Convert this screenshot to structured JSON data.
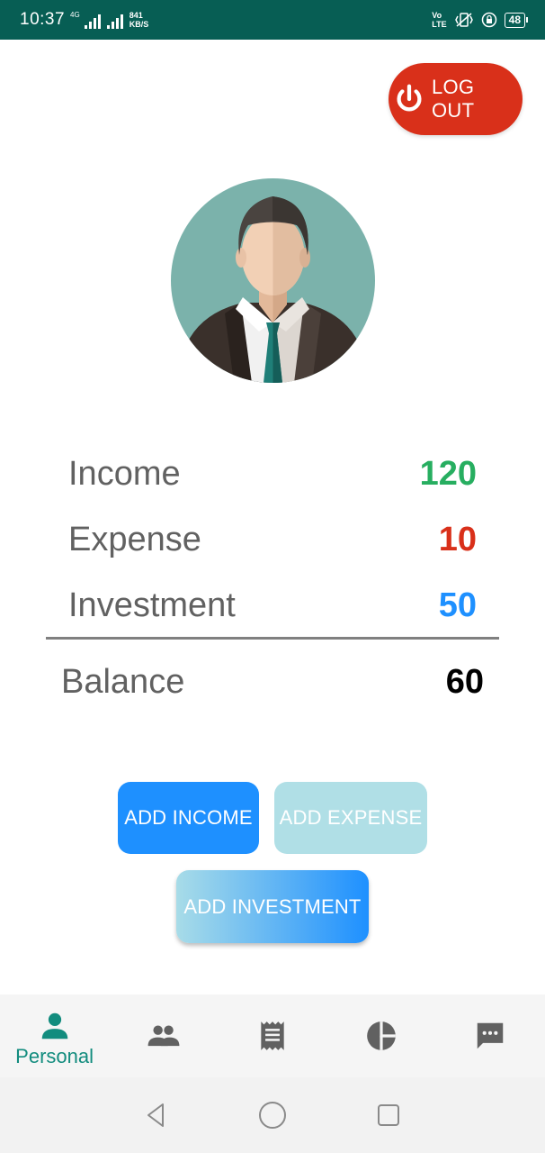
{
  "status_bar": {
    "time": "10:37",
    "network": "4G",
    "speed_value": "841",
    "speed_unit": "KB/S",
    "volte_top": "Vo",
    "volte_bottom": "LTE",
    "battery": "48"
  },
  "header": {
    "logout_label": "LOG OUT",
    "logout_color": "#d9301a"
  },
  "summary": {
    "income_label": "Income",
    "income_value": "120",
    "income_color": "#27ae60",
    "expense_label": "Expense",
    "expense_value": "10",
    "expense_color": "#d9301a",
    "investment_label": "Investment",
    "investment_value": "50",
    "investment_color": "#1e90ff",
    "balance_label": "Balance",
    "balance_value": "60"
  },
  "actions": {
    "add_income": "ADD INCOME",
    "add_expense": "ADD EXPENSE",
    "add_investment": "ADD INVESTMENT"
  },
  "bottom_nav": {
    "items": [
      {
        "icon": "person-icon",
        "label": "Personal",
        "active": true
      },
      {
        "icon": "group-icon",
        "label": "",
        "active": false
      },
      {
        "icon": "receipt-icon",
        "label": "",
        "active": false
      },
      {
        "icon": "pie-chart-icon",
        "label": "",
        "active": false
      },
      {
        "icon": "chat-icon",
        "label": "",
        "active": false
      }
    ],
    "active_color": "#128c7e",
    "inactive_color": "#616161"
  },
  "system_nav": {
    "items": [
      "back-icon",
      "home-icon",
      "recents-icon"
    ]
  }
}
